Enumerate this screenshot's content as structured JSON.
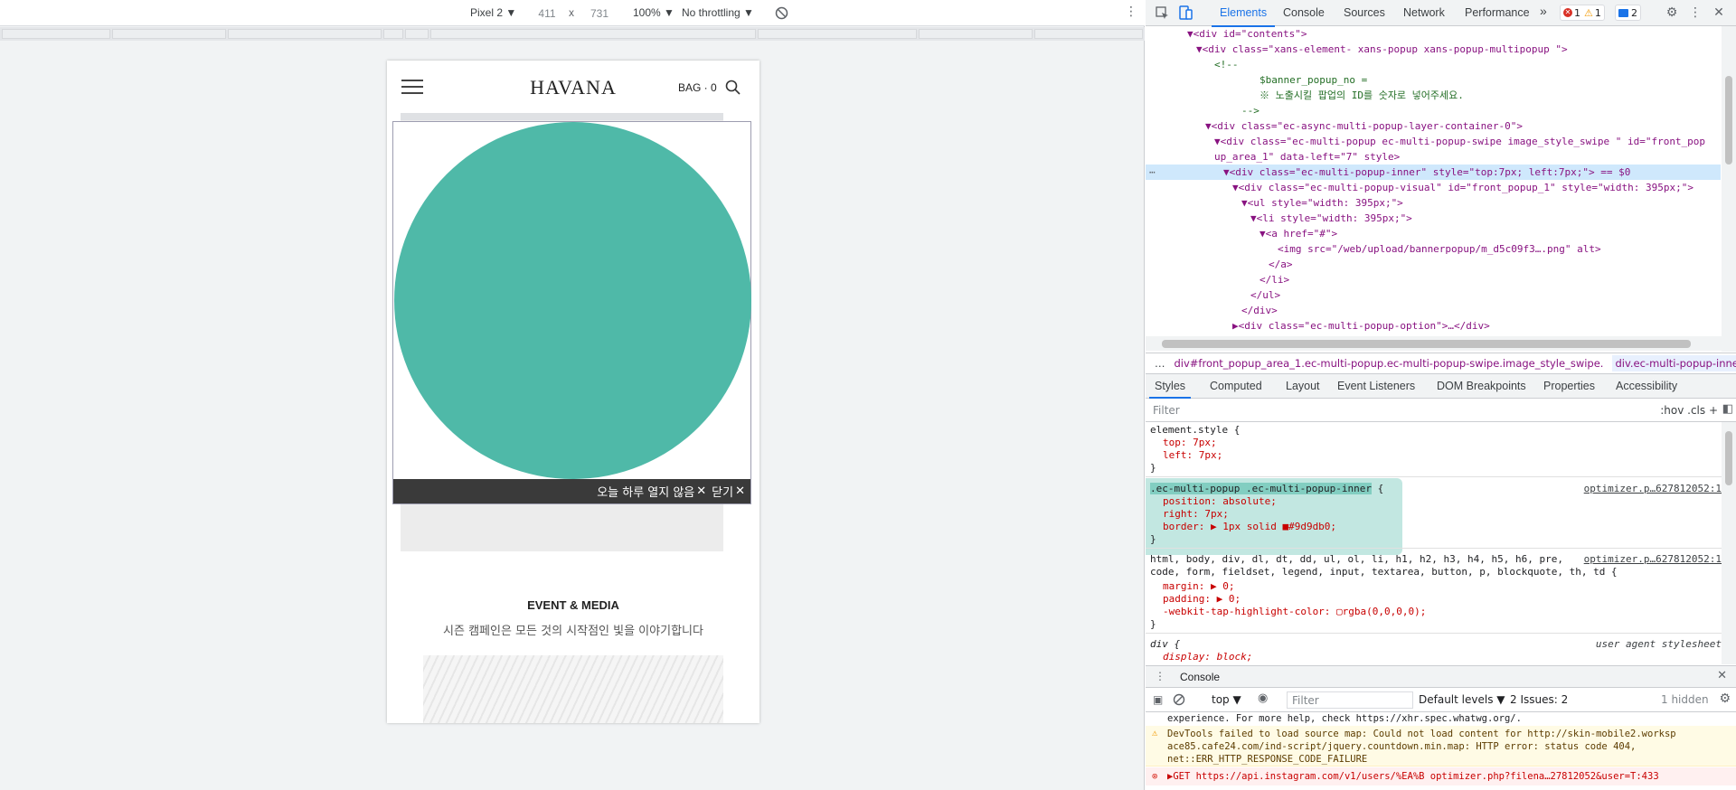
{
  "devbar": {
    "device": "Pixel 2 ▼",
    "width": "411",
    "x": "x",
    "height": "731",
    "zoom": "100% ▼",
    "throttle": "No throttling ▼"
  },
  "phone": {
    "logo": "HAVANA",
    "bag": "BAG · 0",
    "popup_today": "오늘 하루 열지 않음",
    "popup_close": "닫기",
    "popup_x": "✕",
    "event_title": "EVENT & MEDIA",
    "event_sub": "시즌 캠페인은 모든 것의 시작점인 빛을 이야기합니다"
  },
  "devtools": {
    "tabs": [
      "Elements",
      "Console",
      "Sources",
      "Network",
      "Performance"
    ],
    "more": "»",
    "errors": "1",
    "warnings": "1",
    "messages": "2",
    "crumb1": "…",
    "crumb2": "div#front_popup_area_1.ec-multi-popup.ec-multi-popup-swipe.image_style_swipe.",
    "crumb3": "div.ec-multi-popup-inner",
    "crumb4": "…",
    "subtabs": [
      "Styles",
      "Computed",
      "Layout",
      "Event Listeners",
      "DOM Breakpoints",
      "Properties",
      "Accessibility"
    ],
    "filter_placeholder": "Filter",
    "filter_right": ":hov  .cls  +",
    "dom": [
      {
        "t": "▼<div id=\"contents\">",
        "i": 4
      },
      {
        "t": "▼<div class=\"xans-element- xans-popup xans-popup-multipopup \">",
        "i": 5
      },
      {
        "t": "<!--",
        "i": 7
      },
      {
        "t": "$banner_popup_no =",
        "i": 12
      },
      {
        "t": "※ 노출시킬 팝업의 ID를 숫자로 넣어주세요.",
        "i": 12
      },
      {
        "t": "-->",
        "i": 10
      },
      {
        "t": "▼<div class=\"ec-async-multi-popup-layer-container-0\">",
        "i": 6
      },
      {
        "t": "▼<div class=\"ec-multi-popup ec-multi-popup-swipe image_style_swipe \" id=\"front_pop",
        "i": 7
      },
      {
        "t": "up_area_1\" data-left=\"7\" style>",
        "i": 7
      },
      {
        "t": "▼<div class=\"ec-multi-popup-inner\" style=\"top:7px; left:7px;\"> == $0",
        "i": 8
      },
      {
        "t": "▼<div class=\"ec-multi-popup-visual\" id=\"front_popup_1\" style=\"width: 395px;\">",
        "i": 9
      },
      {
        "t": "▼<ul style=\"width: 395px;\">",
        "i": 10
      },
      {
        "t": "▼<li style=\"width: 395px;\">",
        "i": 11
      },
      {
        "t": "▼<a href=\"#\">",
        "i": 12
      },
      {
        "t": "<img src=\"/web/upload/bannerpopup/m_d5c09f3….png\" alt>",
        "i": 14
      },
      {
        "t": "</a>",
        "i": 13
      },
      {
        "t": "</li>",
        "i": 12
      },
      {
        "t": "</ul>",
        "i": 11
      },
      {
        "t": "</div>",
        "i": 10
      },
      {
        "t": "▶<div class=\"ec-multi-popup-option\">…</div>",
        "i": 9
      },
      {
        "t": "</div>",
        "i": 9
      }
    ],
    "styles": {
      "element_style": "element.style {",
      "top": "top: 7px;",
      "left": "left: 7px;",
      "close": "}",
      "selector": ".ec-multi-popup .ec-multi-popup-inner",
      "open": " {",
      "src": "optimizer.p…627812052:1",
      "position": "position: absolute;",
      "right": "right: 7px;",
      "border": "border: ▶ 1px solid ■#9d9db0;",
      "reset_sel1": "html, body, div, dl, dt, dd, ul, ol, li, h1, h2, h3, h4, h5, h6, pre,",
      "reset_sel2": "code, form, fieldset, legend, input, textarea, button, p, blockquote, th, td {",
      "margin": "margin: ▶ 0;",
      "padding": "padding: ▶ 0;",
      "tap": "-webkit-tap-highlight-color: ▢rgba(0,0,0,0);",
      "div_sel": "div {",
      "ua": "user agent stylesheet",
      "display": "display: block;"
    },
    "console": {
      "title": "Console",
      "context": "top ▼",
      "filter": "Filter",
      "levels": "Default levels ▼",
      "issues": "2 Issues: 2",
      "hidden": "1 hidden",
      "msg0": "experience. For more help, check https://xhr.spec.whatwg.org/.",
      "msg1a": "DevTools failed to load source map: Could not load content for http://skin-mobile2.worksp",
      "msg1b": "ace85.cafe24.com/ind-script/jquery.countdown.min.map: HTTP error: status code 404,",
      "msg1c": "net::ERR_HTTP_RESPONSE_CODE_FAILURE",
      "msg2": "▶GET https://api.instagram.com/v1/users/%EA%B   optimizer.php?filena…27812052&user=T:433"
    }
  },
  "colors": {
    "accent": "#1a73e8",
    "popup_circle": "#4fb9a8",
    "highlight": "#4fb9a8"
  }
}
